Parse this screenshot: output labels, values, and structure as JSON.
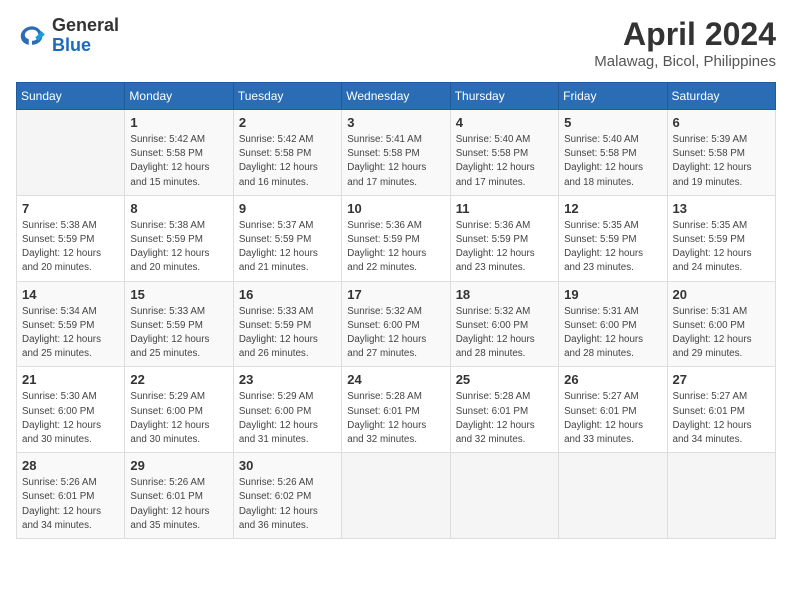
{
  "header": {
    "logo_general": "General",
    "logo_blue": "Blue",
    "month_title": "April 2024",
    "location": "Malawag, Bicol, Philippines"
  },
  "weekdays": [
    "Sunday",
    "Monday",
    "Tuesday",
    "Wednesday",
    "Thursday",
    "Friday",
    "Saturday"
  ],
  "weeks": [
    [
      {
        "day": "",
        "info": ""
      },
      {
        "day": "1",
        "info": "Sunrise: 5:42 AM\nSunset: 5:58 PM\nDaylight: 12 hours\nand 15 minutes."
      },
      {
        "day": "2",
        "info": "Sunrise: 5:42 AM\nSunset: 5:58 PM\nDaylight: 12 hours\nand 16 minutes."
      },
      {
        "day": "3",
        "info": "Sunrise: 5:41 AM\nSunset: 5:58 PM\nDaylight: 12 hours\nand 17 minutes."
      },
      {
        "day": "4",
        "info": "Sunrise: 5:40 AM\nSunset: 5:58 PM\nDaylight: 12 hours\nand 17 minutes."
      },
      {
        "day": "5",
        "info": "Sunrise: 5:40 AM\nSunset: 5:58 PM\nDaylight: 12 hours\nand 18 minutes."
      },
      {
        "day": "6",
        "info": "Sunrise: 5:39 AM\nSunset: 5:58 PM\nDaylight: 12 hours\nand 19 minutes."
      }
    ],
    [
      {
        "day": "7",
        "info": "Sunrise: 5:38 AM\nSunset: 5:59 PM\nDaylight: 12 hours\nand 20 minutes."
      },
      {
        "day": "8",
        "info": "Sunrise: 5:38 AM\nSunset: 5:59 PM\nDaylight: 12 hours\nand 20 minutes."
      },
      {
        "day": "9",
        "info": "Sunrise: 5:37 AM\nSunset: 5:59 PM\nDaylight: 12 hours\nand 21 minutes."
      },
      {
        "day": "10",
        "info": "Sunrise: 5:36 AM\nSunset: 5:59 PM\nDaylight: 12 hours\nand 22 minutes."
      },
      {
        "day": "11",
        "info": "Sunrise: 5:36 AM\nSunset: 5:59 PM\nDaylight: 12 hours\nand 23 minutes."
      },
      {
        "day": "12",
        "info": "Sunrise: 5:35 AM\nSunset: 5:59 PM\nDaylight: 12 hours\nand 23 minutes."
      },
      {
        "day": "13",
        "info": "Sunrise: 5:35 AM\nSunset: 5:59 PM\nDaylight: 12 hours\nand 24 minutes."
      }
    ],
    [
      {
        "day": "14",
        "info": "Sunrise: 5:34 AM\nSunset: 5:59 PM\nDaylight: 12 hours\nand 25 minutes."
      },
      {
        "day": "15",
        "info": "Sunrise: 5:33 AM\nSunset: 5:59 PM\nDaylight: 12 hours\nand 25 minutes."
      },
      {
        "day": "16",
        "info": "Sunrise: 5:33 AM\nSunset: 5:59 PM\nDaylight: 12 hours\nand 26 minutes."
      },
      {
        "day": "17",
        "info": "Sunrise: 5:32 AM\nSunset: 6:00 PM\nDaylight: 12 hours\nand 27 minutes."
      },
      {
        "day": "18",
        "info": "Sunrise: 5:32 AM\nSunset: 6:00 PM\nDaylight: 12 hours\nand 28 minutes."
      },
      {
        "day": "19",
        "info": "Sunrise: 5:31 AM\nSunset: 6:00 PM\nDaylight: 12 hours\nand 28 minutes."
      },
      {
        "day": "20",
        "info": "Sunrise: 5:31 AM\nSunset: 6:00 PM\nDaylight: 12 hours\nand 29 minutes."
      }
    ],
    [
      {
        "day": "21",
        "info": "Sunrise: 5:30 AM\nSunset: 6:00 PM\nDaylight: 12 hours\nand 30 minutes."
      },
      {
        "day": "22",
        "info": "Sunrise: 5:29 AM\nSunset: 6:00 PM\nDaylight: 12 hours\nand 30 minutes."
      },
      {
        "day": "23",
        "info": "Sunrise: 5:29 AM\nSunset: 6:00 PM\nDaylight: 12 hours\nand 31 minutes."
      },
      {
        "day": "24",
        "info": "Sunrise: 5:28 AM\nSunset: 6:01 PM\nDaylight: 12 hours\nand 32 minutes."
      },
      {
        "day": "25",
        "info": "Sunrise: 5:28 AM\nSunset: 6:01 PM\nDaylight: 12 hours\nand 32 minutes."
      },
      {
        "day": "26",
        "info": "Sunrise: 5:27 AM\nSunset: 6:01 PM\nDaylight: 12 hours\nand 33 minutes."
      },
      {
        "day": "27",
        "info": "Sunrise: 5:27 AM\nSunset: 6:01 PM\nDaylight: 12 hours\nand 34 minutes."
      }
    ],
    [
      {
        "day": "28",
        "info": "Sunrise: 5:26 AM\nSunset: 6:01 PM\nDaylight: 12 hours\nand 34 minutes."
      },
      {
        "day": "29",
        "info": "Sunrise: 5:26 AM\nSunset: 6:01 PM\nDaylight: 12 hours\nand 35 minutes."
      },
      {
        "day": "30",
        "info": "Sunrise: 5:26 AM\nSunset: 6:02 PM\nDaylight: 12 hours\nand 36 minutes."
      },
      {
        "day": "",
        "info": ""
      },
      {
        "day": "",
        "info": ""
      },
      {
        "day": "",
        "info": ""
      },
      {
        "day": "",
        "info": ""
      }
    ]
  ]
}
